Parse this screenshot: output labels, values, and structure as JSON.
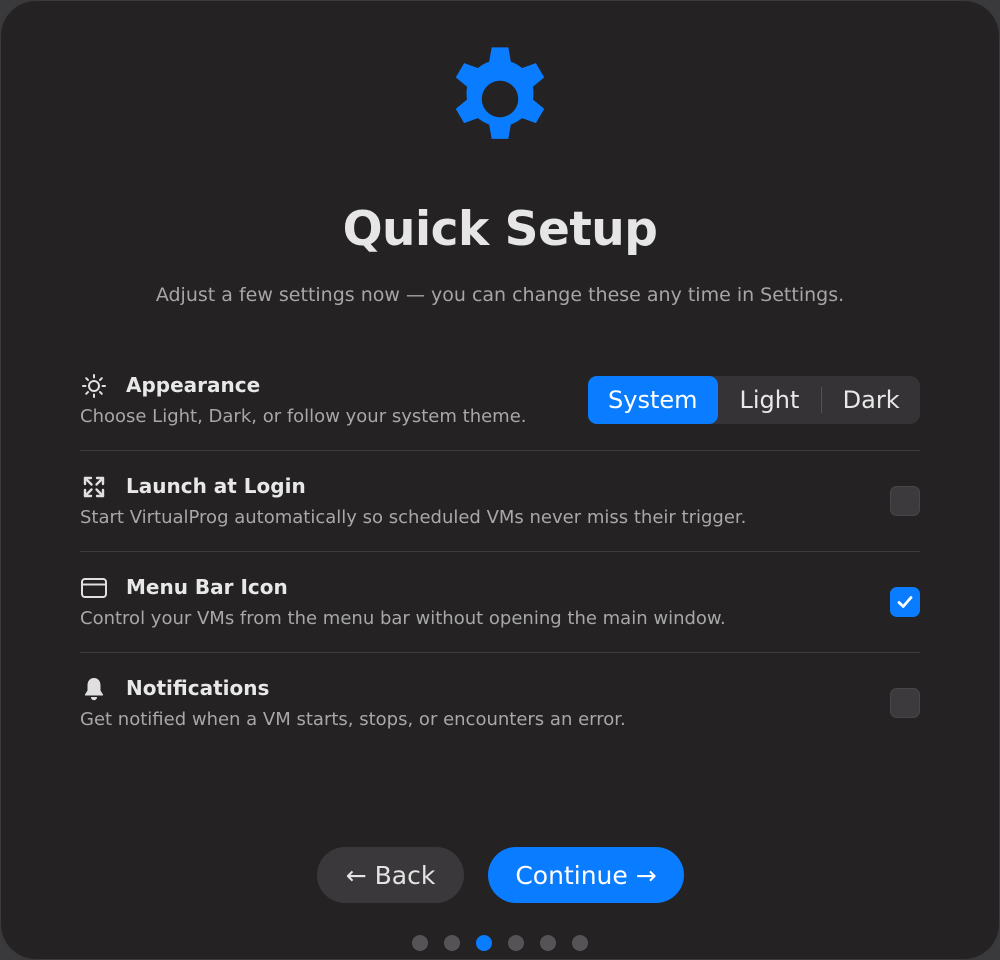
{
  "header": {
    "icon": "gear-icon",
    "title": "Quick Setup",
    "subtitle": "Adjust a few settings now — you can change these any time in Settings."
  },
  "settings": [
    {
      "icon": "sun-icon",
      "label": "Appearance",
      "description": "Choose Light, Dark, or follow your system theme.",
      "control": "segmented",
      "options": [
        "System",
        "Light",
        "Dark"
      ],
      "selected": "System"
    },
    {
      "icon": "expand-arrows-icon",
      "label": "Launch at Login",
      "description": "Start VirtualProg automatically so scheduled VMs never miss their trigger.",
      "control": "checkbox",
      "checked": false
    },
    {
      "icon": "window-icon",
      "label": "Menu Bar Icon",
      "description": "Control your VMs from the menu bar without opening the main window.",
      "control": "checkbox",
      "checked": true
    },
    {
      "icon": "bell-icon",
      "label": "Notifications",
      "description": "Get notified when a VM starts, stops, or encounters an error.",
      "control": "checkbox",
      "checked": false
    }
  ],
  "footer": {
    "back_label": "← Back",
    "continue_label": "Continue →",
    "page_count": 6,
    "current_page": 3
  },
  "colors": {
    "accent": "#0a7cff",
    "background": "#242223"
  }
}
